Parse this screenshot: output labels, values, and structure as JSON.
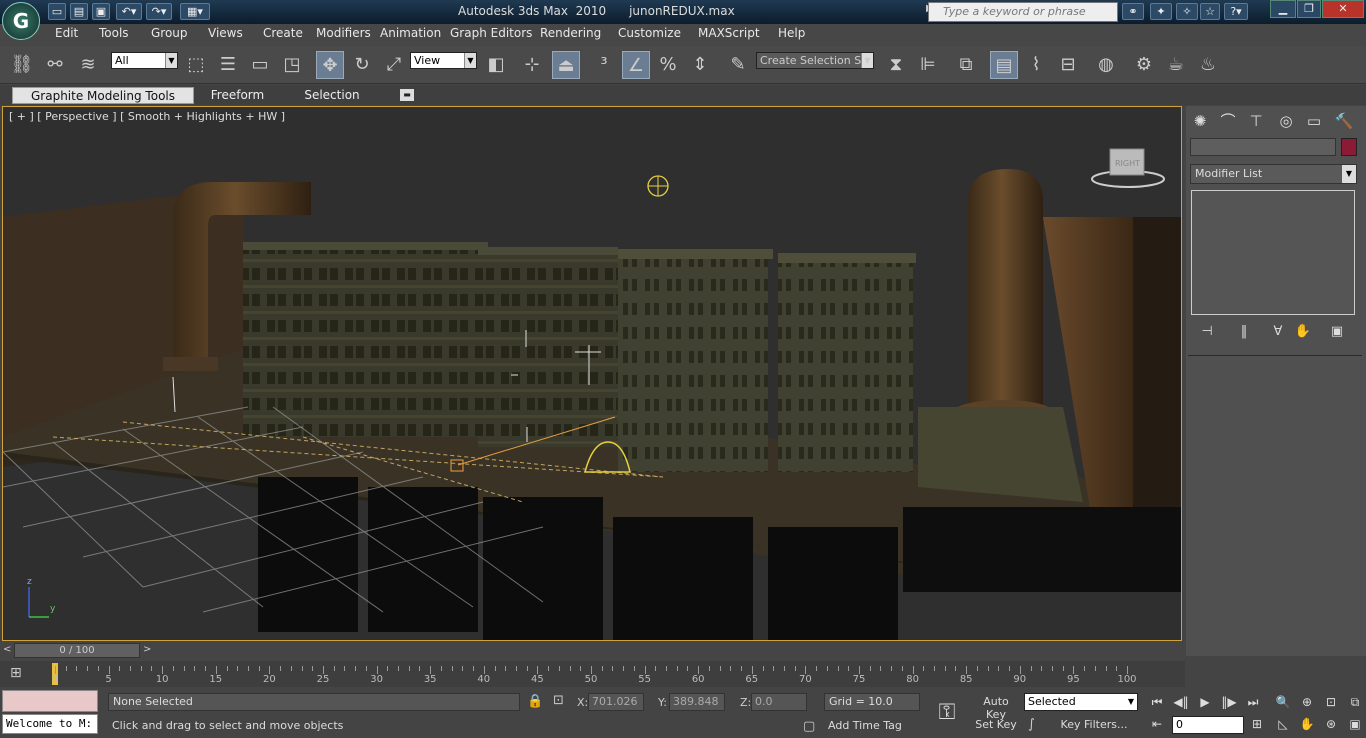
{
  "app": {
    "title": "Autodesk 3ds Max  2010",
    "file": "junonREDUX.max",
    "search_placeholder": "Type a keyword or phrase",
    "logo_icon": "3ds-max-logo"
  },
  "menu": [
    "Edit",
    "Tools",
    "Group",
    "Views",
    "Create",
    "Modifiers",
    "Animation",
    "Graph Editors",
    "Rendering",
    "Customize",
    "MAXScript",
    "Help"
  ],
  "toolbar": {
    "selection_filter": "All",
    "reference_coord": "View",
    "named_selection_placeholder": "Create Selection Se"
  },
  "ribbon": {
    "tabs": [
      "Graphite Modeling Tools",
      "Freeform",
      "Selection"
    ]
  },
  "viewport": {
    "label": "[ + ] [ Perspective ] [ Smooth + Highlights + HW ]",
    "axis_z": "z",
    "axis_y": "y",
    "viewcube_text": "RIGHT"
  },
  "command_panel": {
    "modifier_list": "Modifier List",
    "object_color": "#8b1a36"
  },
  "timeline": {
    "position": "0 / 100",
    "ticks": [
      "0",
      "5",
      "10",
      "15",
      "20",
      "25",
      "30",
      "35",
      "40",
      "45",
      "50",
      "55",
      "60",
      "65",
      "70",
      "75",
      "80",
      "85",
      "90",
      "95",
      "100"
    ]
  },
  "status": {
    "script_listener": "Welcome to M:",
    "selection_info": "None Selected",
    "prompt": "Click and drag to select and move objects",
    "x_label": "X:",
    "x_value": "701.026",
    "y_label": "Y:",
    "y_value": "389.848",
    "z_label": "Z:",
    "z_value": "0.0",
    "grid": "Grid = 10.0",
    "add_time_tag": "Add Time Tag",
    "auto_key": "Auto Key",
    "set_key": "Set Key",
    "key_mode": "Selected",
    "key_filters": "Key Filters...",
    "frame_value": "0"
  }
}
